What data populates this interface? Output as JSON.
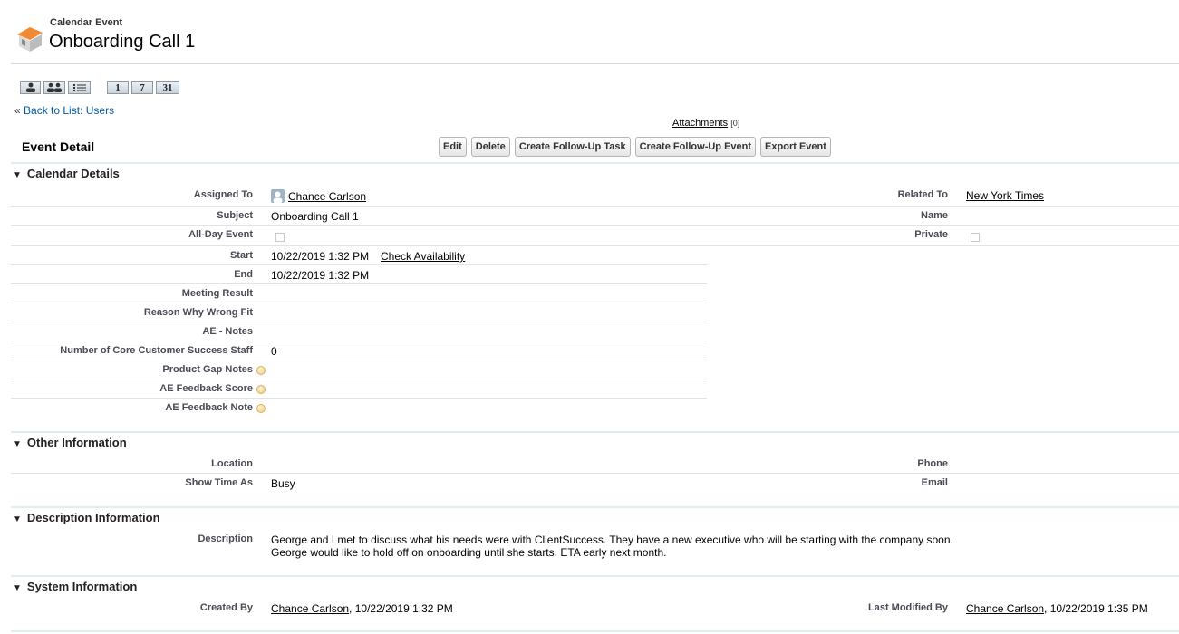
{
  "header": {
    "record_type": "Calendar Event",
    "title": "Onboarding Call 1",
    "icon": "calendar-house-icon"
  },
  "view_buttons": {
    "day": "1",
    "week": "7",
    "month": "31",
    "icons": [
      "single-user-view-icon",
      "multi-user-view-icon",
      "list-view-icon"
    ]
  },
  "back_link": {
    "prefix": "«",
    "label": "Back to List: Users"
  },
  "attachments": {
    "label": "Attachments",
    "count": "[0]"
  },
  "event_detail": {
    "title": "Event Detail",
    "buttons": [
      "Edit",
      "Delete",
      "Create Follow-Up Task",
      "Create Follow-Up Event",
      "Export Event"
    ]
  },
  "calendar_details": {
    "title": "Calendar Details",
    "assigned_to_label": "Assigned To",
    "assigned_to": "Chance Carlson",
    "related_to_label": "Related To",
    "related_to": "New York Times",
    "subject_label": "Subject",
    "subject": "Onboarding Call 1",
    "name_label": "Name",
    "all_day_label": "All-Day Event",
    "private_label": "Private",
    "start_label": "Start",
    "start": "10/22/2019 1:32 PM",
    "check_availability": "Check Availability",
    "end_label": "End",
    "end": "10/22/2019 1:32 PM",
    "meeting_result_label": "Meeting Result",
    "reason_label": "Reason Why Wrong Fit",
    "ae_notes_label": "AE - Notes",
    "core_staff_label": "Number of Core Customer Success Staff",
    "core_staff": "0",
    "product_gap_label": "Product Gap Notes",
    "ae_score_label": "AE Feedback Score",
    "ae_note_label": "AE Feedback Note"
  },
  "other_information": {
    "title": "Other Information",
    "location_label": "Location",
    "phone_label": "Phone",
    "show_time_label": "Show Time As",
    "show_time": "Busy",
    "email_label": "Email"
  },
  "description_information": {
    "title": "Description Information",
    "description_label": "Description",
    "line1": "George and I met to discuss what his needs were with ClientSuccess. They have a new executive who will be starting with the company soon.",
    "line2": "George would like to hold off on onboarding until she starts. ETA early next month."
  },
  "system_information": {
    "title": "System Information",
    "created_by_label": "Created By",
    "created_by": "Chance Carlson",
    "created_date": ", 10/22/2019 1:32 PM",
    "modified_by_label": "Last Modified By",
    "modified_by": "Chance Carlson",
    "modified_date": ", 10/22/2019 1:35 PM"
  },
  "colors": {
    "section_divider": "#e0eef2",
    "link_blue": "#015ba7",
    "label_gray": "#4a4a56"
  }
}
